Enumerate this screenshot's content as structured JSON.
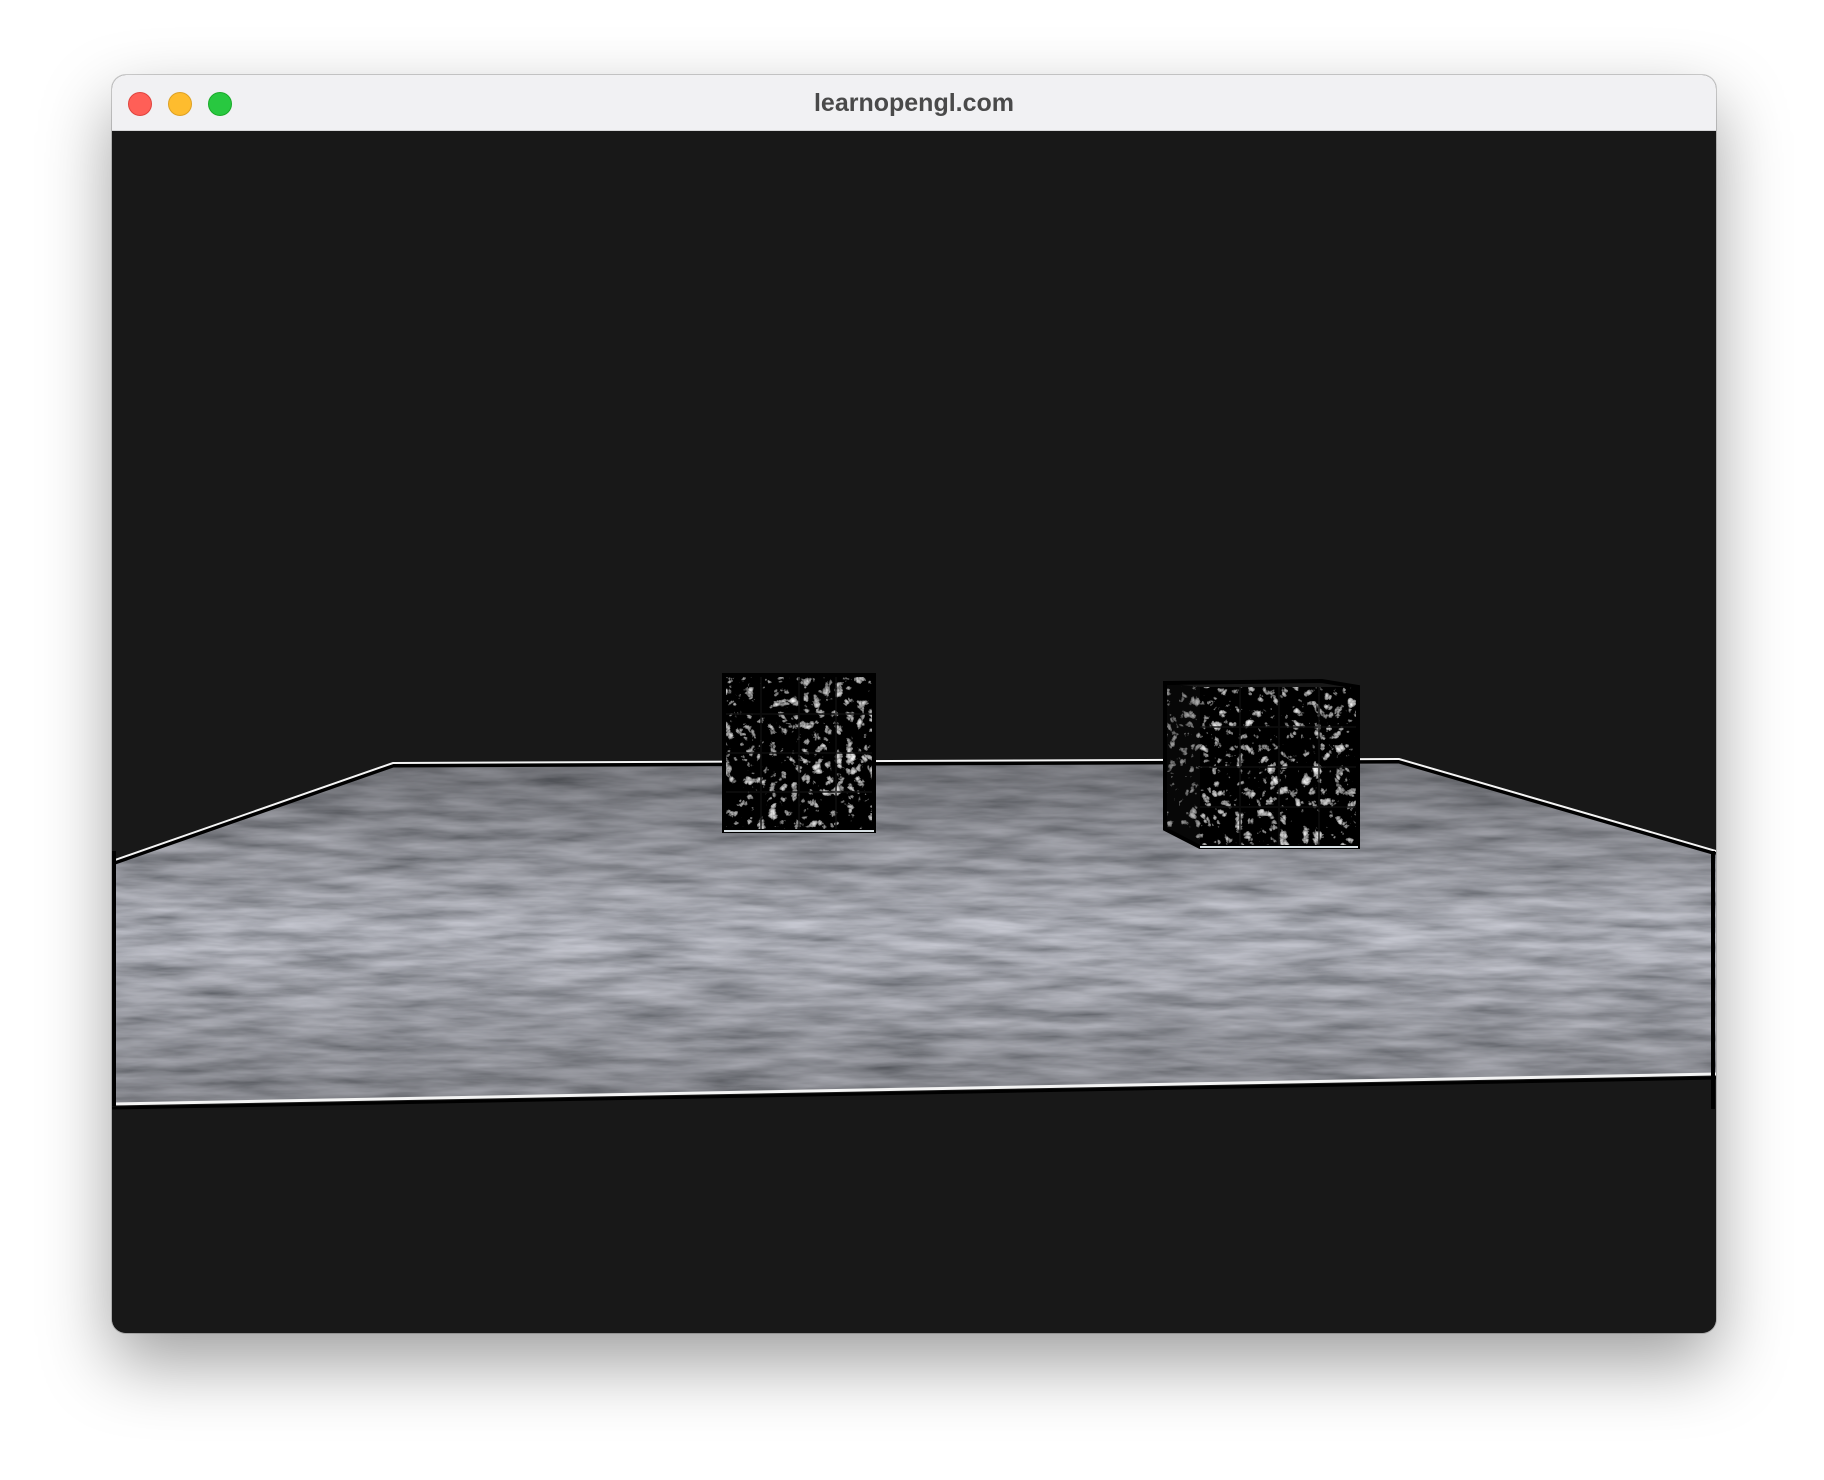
{
  "window": {
    "title": "learnopengl.com"
  },
  "controls": {
    "close": "close-button",
    "minimize": "minimize-button",
    "zoom": "zoom-button"
  },
  "colors": {
    "titlebar": "#f1f1f3",
    "background": "#181818",
    "close": "#ff5f57",
    "minimize": "#febc2e",
    "zoom": "#28c840"
  }
}
